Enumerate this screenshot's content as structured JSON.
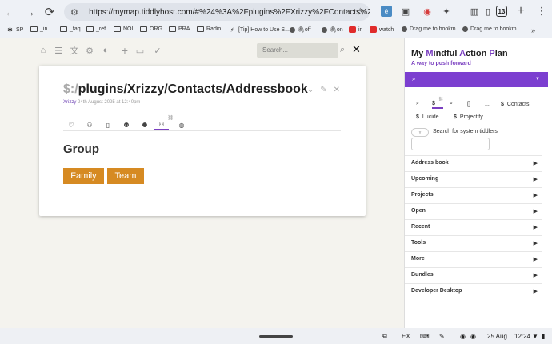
{
  "browser": {
    "url": "https://mymap.tiddlyhost.com/#%24%3A%2Fplugins%2FXrizzy%2FContacts%2FAddressbook",
    "tab_count": "13",
    "bookmarks": [
      {
        "label": "SP",
        "icon": "sparkle-icon"
      },
      {
        "label": "_in",
        "icon": "folder-icon"
      },
      {
        "label": "_faq",
        "icon": "folder-icon"
      },
      {
        "label": "_ref",
        "icon": "folder-icon"
      },
      {
        "label": "NOI",
        "icon": "folder-icon"
      },
      {
        "label": "ORG",
        "icon": "folder-icon"
      },
      {
        "label": "PRA",
        "icon": "folder-icon"
      },
      {
        "label": "Radio",
        "icon": "folder-icon"
      },
      {
        "label": "[Tip] How to Use S...",
        "icon": "tip-icon"
      },
      {
        "label": "🖇off",
        "icon": "github-icon"
      },
      {
        "label": "🖇on",
        "icon": "github-icon"
      },
      {
        "label": "in",
        "icon": "youtube-icon"
      },
      {
        "label": "watch",
        "icon": "youtube-icon"
      },
      {
        "label": "Drag me to bookm...",
        "icon": "github-icon"
      },
      {
        "label": "Drag me to bookm...",
        "icon": "github-icon"
      }
    ]
  },
  "river": {
    "search_placeholder": "Search..."
  },
  "tiddler": {
    "title_prefix": "$:/",
    "title_rest": "plugins/Xrizzy/Contacts/Addressbook",
    "modifier": "Xrizzy",
    "date": "24th August 2025 at 12:40pm",
    "heading": "Group",
    "tags": [
      "Family",
      "Team"
    ]
  },
  "sidebar": {
    "title_parts": [
      {
        "text": "My ",
        "hl": false
      },
      {
        "text": "M",
        "hl": true
      },
      {
        "text": "indful ",
        "hl": false
      },
      {
        "text": "A",
        "hl": true
      },
      {
        "text": "ction ",
        "hl": false
      },
      {
        "text": "P",
        "hl": true
      },
      {
        "text": "lan",
        "hl": false
      }
    ],
    "subtitle": "A way to push forward",
    "tabs": {
      "t1": "🔍",
      "t2": "$",
      "t3": "🔍",
      "t4": "[]",
      "t5": "...",
      "contacts": "Contacts",
      "lucide": "Lucide",
      "projectify": "Projectify",
      "dollar": "$"
    },
    "search_label": "Search for system tiddlers",
    "search_icon_text": "▿",
    "accordion": [
      "Address book",
      "Upcoming",
      "Projects",
      "Open",
      "Recent",
      "Tools",
      "More",
      "Bundles",
      "Developer Desktop"
    ]
  },
  "taskbar": {
    "ex_label": "EX",
    "date": "25 Aug",
    "time": "12:24"
  }
}
